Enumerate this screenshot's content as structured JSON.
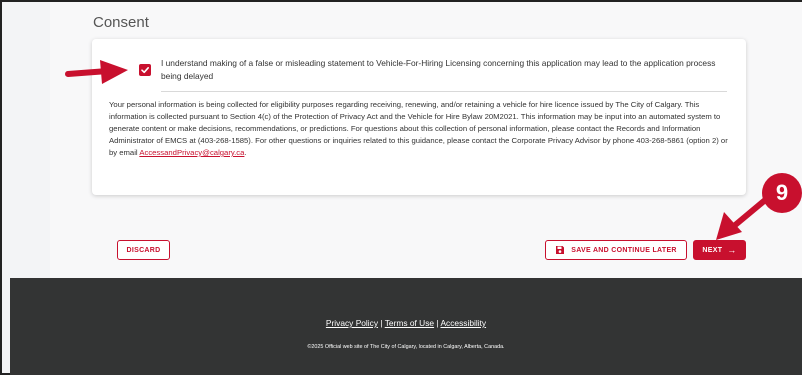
{
  "section": {
    "title": "Consent"
  },
  "consent": {
    "checkbox_checked": true,
    "label": "I understand making of a false or misleading statement to Vehicle-For-Hiring Licensing concerning this application may lead to the application process being delayed",
    "privacy_text": "Your personal information is being collected for eligibility purposes regarding receiving, renewing, and/or retaining a vehicle for hire licence issued by The City of Calgary. This information is collected pursuant to Section 4(c) of the Protection of Privacy Act and the Vehicle for Hire Bylaw 20M2021. This information may be input into an automated system to generate content or make decisions, recommendations, or predictions. For questions about this collection of personal information, please contact the Records and Information Administrator of EMCS at (403-268-1585). For other questions or inquiries related to this guidance, please contact the Corporate Privacy Advisor by phone 403-268-5861 (option 2) or by email ",
    "privacy_email": "AccessandPrivacy@calgary.ca",
    "privacy_end": "."
  },
  "actions": {
    "discard": "DISCARD",
    "save_later": "SAVE AND CONTINUE LATER",
    "next": "NEXT",
    "next_icon": "arrow-right-icon",
    "save_icon": "floppy-disk-icon"
  },
  "annotation": {
    "step_number": "9"
  },
  "footer": {
    "privacy_policy": "Privacy Policy",
    "separator": "|",
    "terms_of_use": "Terms of Use",
    "accessibility": "Accessibility",
    "copyright": "©2025 Official web site of The City of Calgary, located in Calgary, Alberta, Canada."
  },
  "colors": {
    "accent": "#c8102e",
    "footer_bg": "#333434",
    "page_bg": "#f8f8f9"
  }
}
